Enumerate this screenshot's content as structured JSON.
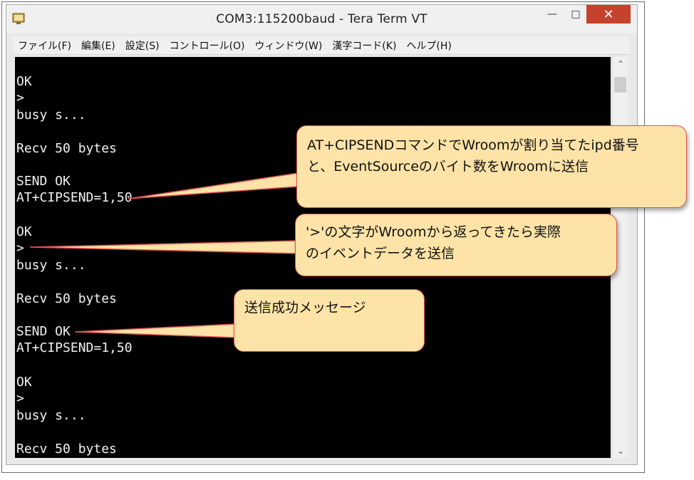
{
  "window": {
    "title": "COM3:115200baud - Tera Term VT"
  },
  "menu": [
    "ファイル(F)",
    "編集(E)",
    "設定(S)",
    "コントロール(O)",
    "ウィンドウ(W)",
    "漢字コード(K)",
    "ヘルプ(H)"
  ],
  "terminal": {
    "lines": [
      "OK",
      ">",
      "busy s...",
      "",
      "Recv 50 bytes",
      "",
      "SEND OK",
      "AT+CIPSEND=1,50",
      "",
      "OK",
      ">",
      "busy s...",
      "",
      "Recv 50 bytes",
      "",
      "SEND OK",
      "AT+CIPSEND=1,50",
      "",
      "OK",
      ">",
      "busy s...",
      "",
      "Recv 50 bytes"
    ]
  },
  "callouts": {
    "c1": {
      "line1": "AT+CIPSENDコマンドでWroomが割り当てたipd番号",
      "line2": "と、EventSourceのバイト数をWroomに送信"
    },
    "c2": {
      "line1": "'>'の文字がWroomから返ってきたら実際",
      "line2": "のイベントデータを送信"
    },
    "c3": {
      "line1": "送信成功メッセージ"
    }
  },
  "colors": {
    "callout_fill": "#fde3a7",
    "callout_border": "#d9534f",
    "close_button": "#c6422c",
    "terminal_bg": "#000000",
    "terminal_text": "#f2f2f2"
  }
}
